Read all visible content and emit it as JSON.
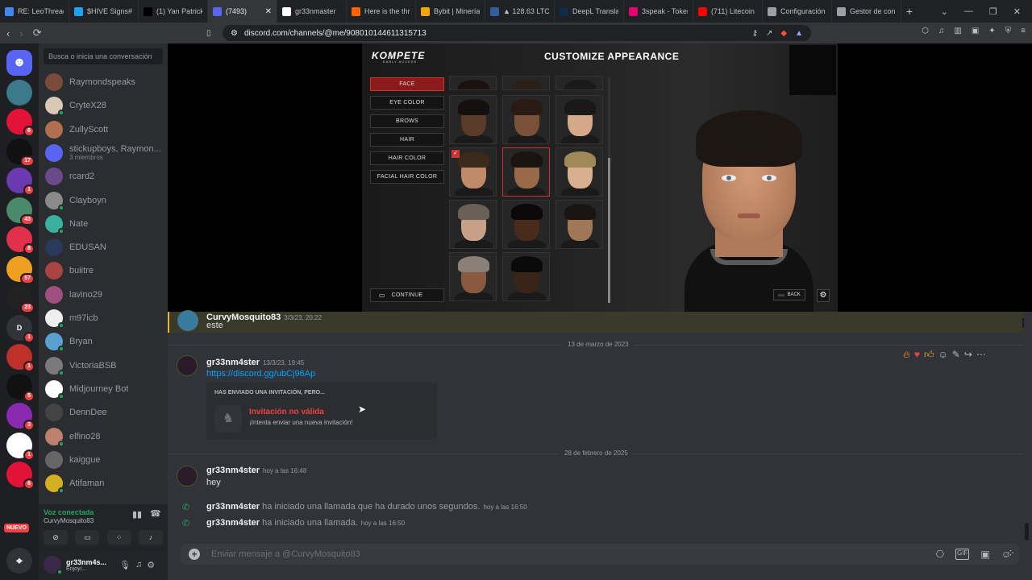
{
  "browser": {
    "tabs": [
      {
        "title": "RE: LeoThread",
        "color": "#4285f4"
      },
      {
        "title": "$HIVE Signs# a",
        "color": "#1da1f2"
      },
      {
        "title": "(1) Yan Patrick",
        "color": "#000000"
      },
      {
        "title": "(7493)",
        "color": "#5865f2"
      },
      {
        "title": "gr33nmaster",
        "color": "#ffffff"
      },
      {
        "title": "Here is the thr",
        "color": "#ff6600"
      },
      {
        "title": "Bybit | Minería",
        "color": "#f7a600"
      },
      {
        "title": "▲ 128.63 LTCU",
        "color": "#345d9d"
      },
      {
        "title": "DeepL Translat",
        "color": "#0f2b46"
      },
      {
        "title": "3speak - Token",
        "color": "#e5006d"
      },
      {
        "title": "(711) Litecoin",
        "color": "#ff0000"
      },
      {
        "title": "Configuración",
        "color": "#9aa0a6"
      },
      {
        "title": "Gestor de con",
        "color": "#9aa0a6"
      }
    ],
    "url": "discord.com/channels/@me/908010144611315713"
  },
  "sidebar": {
    "search_placeholder": "Busca o inicia una conversación",
    "dms": [
      {
        "name": "Raymondspeaks",
        "sub": "",
        "color": "#7a4a3a"
      },
      {
        "name": "CryteX28",
        "sub": "",
        "color": "#d8c8b8"
      },
      {
        "name": "ZullyScott",
        "sub": "",
        "color": "#b07050"
      },
      {
        "name": "stickupboys, Raymon...",
        "sub": "3 miembros",
        "color": "#5865f2"
      },
      {
        "name": "rcard2",
        "sub": "",
        "color": "#6a4a8a"
      },
      {
        "name": "Clayboyn",
        "sub": "",
        "color": "#8a8a8a"
      },
      {
        "name": "Nate",
        "sub": "",
        "color": "#3ab0a0"
      },
      {
        "name": "EDUSAN",
        "sub": "",
        "color": "#2a3a5a"
      },
      {
        "name": "buiitre",
        "sub": "",
        "color": "#aa4444"
      },
      {
        "name": "lavino29",
        "sub": "",
        "color": "#a05080"
      },
      {
        "name": "m97icb",
        "sub": "",
        "color": "#eeeeee"
      },
      {
        "name": "Bryan",
        "sub": "",
        "color": "#5aa0d0"
      },
      {
        "name": "VictoriaBSB",
        "sub": "",
        "color": "#7a7a7a"
      },
      {
        "name": "Midjourney Bot",
        "sub": "",
        "color": "#ffffff"
      },
      {
        "name": "DennDee",
        "sub": "",
        "color": "#444444"
      },
      {
        "name": "elfino28",
        "sub": "",
        "color": "#c08070"
      },
      {
        "name": "kaiggue",
        "sub": "",
        "color": "#666666"
      },
      {
        "name": "Atifaman",
        "sub": "",
        "color": "#d4b020"
      }
    ],
    "voice_status": "Voz conectada",
    "voice_channel": "CurvyMosquito83",
    "user_name": "gr33nm4s...",
    "user_status": "Enjoyi..."
  },
  "servers": [
    {
      "badge": "",
      "color": "#5865f2"
    },
    {
      "badge": "",
      "color": "#3b7a8a"
    },
    {
      "badge": "6",
      "color": "#e31337"
    },
    {
      "badge": "17",
      "color": "#111111"
    },
    {
      "badge": "1",
      "color": "#6a3ab0"
    },
    {
      "badge": "43",
      "color": "#4a8a6a"
    },
    {
      "badge": "8",
      "color": "#e0304a"
    },
    {
      "badge": "57",
      "color": "#f0a020"
    },
    {
      "badge": "23",
      "color": "#222222"
    },
    {
      "badge": "1",
      "color": "#313338",
      "letter": "D"
    },
    {
      "badge": "1",
      "color": "#c0302a"
    },
    {
      "badge": "5",
      "color": "#111111"
    },
    {
      "badge": "3",
      "color": "#8a2ab0"
    },
    {
      "badge": "1",
      "color": "#ffffff"
    },
    {
      "badge": "6",
      "color": "#e31337"
    }
  ],
  "server_new_label": "NUEVO",
  "game": {
    "logo": "KOMPETE",
    "logo_sub": "EARLY ACCESS",
    "title": "CUSTOMIZE APPEARANCE",
    "menu": [
      "FACE",
      "EYE COLOR",
      "BROWS",
      "HAIR",
      "HAIR COLOR",
      "FACIAL HAIR COLOR"
    ],
    "continue": "CONTINUE",
    "back": "BACK",
    "esc": "ESC"
  },
  "chat": {
    "pinned": {
      "user": "CurvyMosquito83",
      "time": "3/3/23, 20:22",
      "text": "este"
    },
    "date1": "13 de marzo de 2023",
    "msg1": {
      "user": "gr33nm4ster",
      "time": "13/3/23, 19:45",
      "link": "https://discord.gg/ubCj96Ap"
    },
    "invite": {
      "header": "HAS ENVIADO UNA INVITACIÓN, PERO...",
      "title": "Invitación no válida",
      "sub": "¡Intenta enviar una nueva invitación!"
    },
    "date2": "28 de febrero de 2025",
    "msg2": {
      "user": "gr33nm4ster",
      "time": "hoy a las 16:48",
      "text": "hey"
    },
    "call1": {
      "user": "gr33nm4ster",
      "text": "ha iniciado una llamada que ha durado unos segundos.",
      "time": "hoy a las 16:50"
    },
    "call2": {
      "user": "gr33nm4ster",
      "text": "ha iniciado una llamada.",
      "time": "hoy a las 16:50"
    },
    "composer_placeholder": "Enviar mensaje a @CurvyMosquito83"
  }
}
